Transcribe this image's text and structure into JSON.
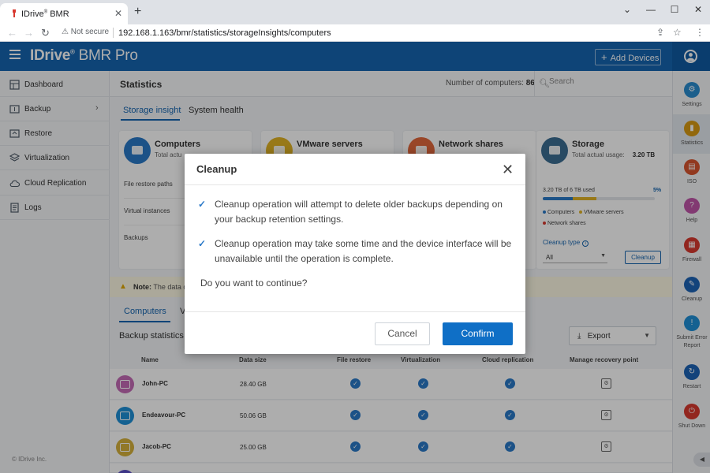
{
  "browser": {
    "tab_title": "IDrive",
    "tab_title_reg": "®",
    "tab_title_suffix": " BMR",
    "tab_close": "✕",
    "new_tab": "+",
    "security_label": "Not secure",
    "url": "192.168.1.163/bmr/statistics/storageInsights/computers",
    "win_minimize": "⌄",
    "win_min": "—",
    "win_max": "☐",
    "win_close": "✕"
  },
  "header": {
    "brand_main": "IDrive",
    "brand_reg": "®",
    "brand_bmr": " BMR",
    "brand_pro": " Pro",
    "add_devices_label": "Add Devices"
  },
  "sidebar": {
    "items": [
      {
        "label": "Dashboard",
        "icon": "dashboard-icon"
      },
      {
        "label": "Backup",
        "icon": "backup-icon"
      },
      {
        "label": "Restore",
        "icon": "restore-icon"
      },
      {
        "label": "Virtualization",
        "icon": "virtualization-icon"
      },
      {
        "label": "Cloud Replication",
        "icon": "cloud-icon"
      },
      {
        "label": "Logs",
        "icon": "logs-icon"
      }
    ],
    "copyright": "© IDrive Inc."
  },
  "statistics": {
    "title": "Statistics",
    "computers_label": "Number of computers:",
    "computers_value": "86",
    "search_placeholder": "Search",
    "tabs": [
      "Storage insight",
      "System health"
    ]
  },
  "cards": {
    "computers": {
      "title": "Computers",
      "sub": "Total actu",
      "rows": [
        "File restore paths",
        "Virtual instances",
        "Backups"
      ]
    },
    "vmware": {
      "title": "VMware servers"
    },
    "network": {
      "title": "Network shares"
    },
    "storage": {
      "title": "Storage",
      "total_label": "Total actual usage:",
      "total_value": "3.20 TB",
      "used_label": "3.20 TB of 6 TB used",
      "used_percent": "5%",
      "legend": [
        "Computers",
        "VMware servers",
        "Network shares"
      ],
      "cleanup_type_label": "Cleanup type",
      "cleanup_type_value": "All",
      "cleanup_button": "Cleanup"
    }
  },
  "colors": {
    "brand_blue": "#1565b0",
    "computers": "#2a79c8",
    "vmware": "#e0b325",
    "network": "#d8382f"
  },
  "note": {
    "label": "Note:",
    "text": "The data c"
  },
  "sub_tabs": [
    "Computers",
    "V"
  ],
  "backup_statistics": {
    "title": "Backup statistics",
    "export_label": "Export",
    "columns": [
      "Name",
      "Data size",
      "File restore",
      "Virtualization",
      "Cloud replication",
      "Manage recovery point"
    ],
    "rows": [
      {
        "name": "John-PC",
        "size": "28.40 GB",
        "color": "#c46bb5"
      },
      {
        "name": "Endeavour-PC",
        "size": "50.06 GB",
        "color": "#1e8fd6"
      },
      {
        "name": "Jacob-PC",
        "size": "25.00 GB",
        "color": "#d6b23b"
      }
    ]
  },
  "right_rail": {
    "items": [
      {
        "label": "Settings",
        "icon": "settings-icon",
        "color": "#2a8ccf"
      },
      {
        "label": "Statistics",
        "icon": "statistics-icon",
        "color": "#d79a12"
      },
      {
        "label": "ISO",
        "icon": "iso-icon",
        "color": "#d8552e"
      },
      {
        "label": "Help",
        "icon": "help-icon",
        "color": "#c054a8"
      },
      {
        "label": "Firewall",
        "icon": "firewall-icon",
        "color": "#d8382f"
      },
      {
        "label": "Cleanup",
        "icon": "cleanup-icon",
        "color": "#1d63b5"
      },
      {
        "label": "Submit Error Report",
        "icon": "error-report-icon",
        "color": "#1f8fd6"
      },
      {
        "label": "Restart",
        "icon": "restart-icon",
        "color": "#1d63b5"
      },
      {
        "label": "Shut Down",
        "icon": "power-icon",
        "color": "#d8382f"
      }
    ]
  },
  "modal": {
    "title": "Cleanup",
    "lines": [
      "Cleanup operation will attempt to delete older backups depending on your backup retention settings.",
      "Cleanup operation may take some time and the device interface will be unavailable until the operation is complete."
    ],
    "question": "Do you want to continue?",
    "cancel": "Cancel",
    "confirm": "Confirm"
  }
}
